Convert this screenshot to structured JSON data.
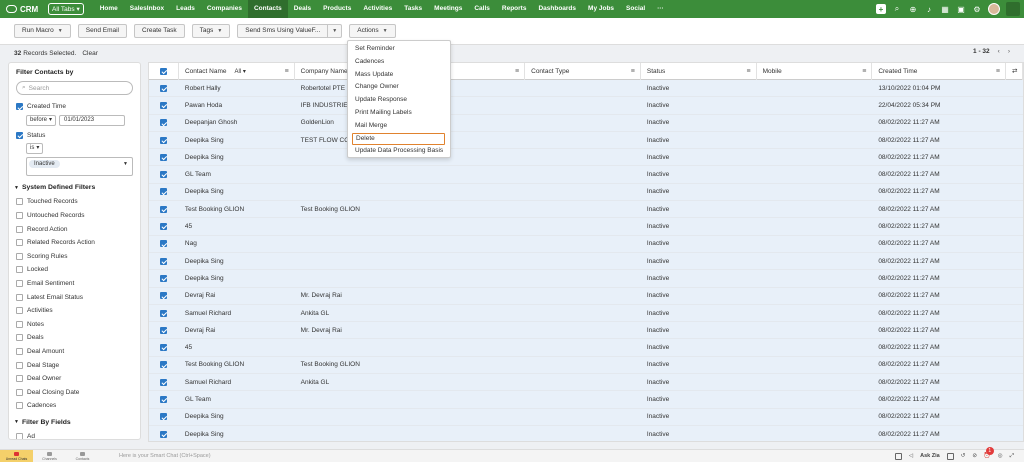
{
  "app": {
    "brand": "CRM",
    "all_tabs": "All Tabs"
  },
  "nav": {
    "tabs": [
      "Home",
      "SalesInbox",
      "Leads",
      "Companies",
      "Contacts",
      "Deals",
      "Products",
      "Activities",
      "Tasks",
      "Meetings",
      "Calls",
      "Reports",
      "Dashboards",
      "My Jobs",
      "Social"
    ],
    "active": "Contacts",
    "more": "···"
  },
  "toolbar": {
    "run_macro": "Run Macro",
    "send_email": "Send Email",
    "create_task": "Create Task",
    "tags": "Tags",
    "send_sms": "Send Sms Using ValueF...",
    "actions": "Actions"
  },
  "selection": {
    "count": "32",
    "text": "Records Selected.",
    "clear": "Clear"
  },
  "pager": {
    "range": "1 - 32",
    "prev": "‹",
    "next": "›"
  },
  "filters": {
    "title": "Filter Contacts by",
    "search_placeholder": "Search",
    "created_time": {
      "label": "Created Time",
      "operator": "before",
      "value": "01/01/2023"
    },
    "status": {
      "label": "Status",
      "operator": "is",
      "value": "Inactive"
    },
    "system_section": "System Defined Filters",
    "system_items": [
      "Touched Records",
      "Untouched Records",
      "Record Action",
      "Related Records Action",
      "Scoring Rules",
      "Locked",
      "Email Sentiment",
      "Latest Email Status",
      "Activities",
      "Notes",
      "Deals",
      "Deal Amount",
      "Deal Stage",
      "Deal Owner",
      "Deal Closing Date",
      "Cadences"
    ],
    "fields_section": "Filter By Fields",
    "fields_items": [
      "Ad"
    ]
  },
  "table": {
    "headers": {
      "name": "Contact Name",
      "name_filter": "All",
      "company": "Company Name",
      "type": "Contact Type",
      "status": "Status",
      "mobile": "Mobile",
      "created": "Created Time"
    },
    "rows": [
      [
        "Robert Hally",
        "Robertotel PTE",
        "",
        "Inactive",
        "",
        "13/10/2022 01:04 PM"
      ],
      [
        "Pawan Hoda",
        "IFB INDUSTRIES",
        "",
        "Inactive",
        "",
        "22/04/2022 05:34 PM"
      ],
      [
        "Deepanjan Ghosh",
        "GoldenLion",
        "",
        "Inactive",
        "",
        "08/02/2022 11:27 AM"
      ],
      [
        "Deepika Sing",
        "TEST FLOW CO",
        "",
        "Inactive",
        "",
        "08/02/2022 11:27 AM"
      ],
      [
        "Deepika Sing",
        "",
        "",
        "Inactive",
        "",
        "08/02/2022 11:27 AM"
      ],
      [
        "GL Team",
        "",
        "",
        "Inactive",
        "",
        "08/02/2022 11:27 AM"
      ],
      [
        "Deepika Sing",
        "",
        "",
        "Inactive",
        "",
        "08/02/2022 11:27 AM"
      ],
      [
        "Test Booking GLION",
        "Test Booking GLION",
        "",
        "Inactive",
        "",
        "08/02/2022 11:27 AM"
      ],
      [
        "45",
        "",
        "",
        "Inactive",
        "",
        "08/02/2022 11:27 AM"
      ],
      [
        "Nag",
        "",
        "",
        "Inactive",
        "",
        "08/02/2022 11:27 AM"
      ],
      [
        "Deepika Sing",
        "",
        "",
        "Inactive",
        "",
        "08/02/2022 11:27 AM"
      ],
      [
        "Deepika Sing",
        "",
        "",
        "Inactive",
        "",
        "08/02/2022 11:27 AM"
      ],
      [
        "Devraj Rai",
        "Mr. Devraj Rai",
        "",
        "Inactive",
        "",
        "08/02/2022 11:27 AM"
      ],
      [
        "Samuel Richard",
        "Ankita GL",
        "",
        "Inactive",
        "",
        "08/02/2022 11:27 AM"
      ],
      [
        "Devraj Rai",
        "Mr. Devraj Rai",
        "",
        "Inactive",
        "",
        "08/02/2022 11:27 AM"
      ],
      [
        "45",
        "",
        "",
        "Inactive",
        "",
        "08/02/2022 11:27 AM"
      ],
      [
        "Test Booking GLION",
        "Test Booking GLION",
        "",
        "Inactive",
        "",
        "08/02/2022 11:27 AM"
      ],
      [
        "Samuel Richard",
        "Ankita GL",
        "",
        "Inactive",
        "",
        "08/02/2022 11:27 AM"
      ],
      [
        "GL Team",
        "",
        "",
        "Inactive",
        "",
        "08/02/2022 11:27 AM"
      ],
      [
        "Deepika Sing",
        "",
        "",
        "Inactive",
        "",
        "08/02/2022 11:27 AM"
      ],
      [
        "Deepika Sing",
        "",
        "",
        "Inactive",
        "",
        "08/02/2022 11:27 AM"
      ]
    ]
  },
  "actions_menu": {
    "items": [
      "Set Reminder",
      "Cadences",
      "Mass Update",
      "Change Owner",
      "Update Response",
      "Print Mailing Labels",
      "Mail Merge",
      "Delete",
      "Update Data Processing Basis"
    ],
    "highlighted": "Delete"
  },
  "bottombar": {
    "items": [
      "Unread Chats",
      "Channels",
      "Contacts"
    ],
    "smartchat_placeholder": "Here is your Smart Chat (Ctrl+Space)",
    "ask_zia": "Ask Zia",
    "notification_count": "1"
  },
  "colors": {
    "nav_green": "#3c8d3a",
    "nav_active": "#2f6e2d",
    "row_selected": "#e8f0f9",
    "checkbox": "#2b78c5",
    "highlight_border": "#e0822e"
  }
}
